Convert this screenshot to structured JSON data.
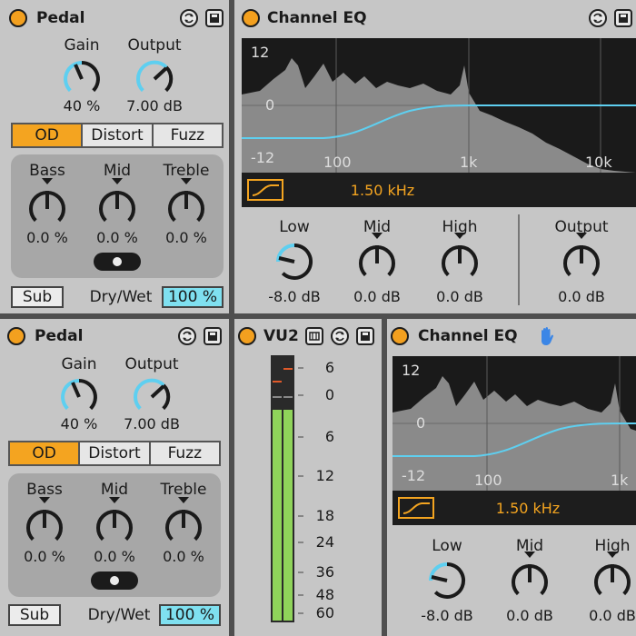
{
  "pedal1": {
    "title": "Pedal",
    "gain_label": "Gain",
    "gain_value": "40 %",
    "output_label": "Output",
    "output_value": "7.00 dB",
    "modes": [
      "OD",
      "Distort",
      "Fuzz"
    ],
    "active_mode": "OD",
    "bass_label": "Bass",
    "bass_value": "0.0 %",
    "mid_label": "Mid",
    "mid_value": "0.0 %",
    "treble_label": "Treble",
    "treble_value": "0.0 %",
    "sub_label": "Sub",
    "drywet_label": "Dry/Wet",
    "drywet_value": "100 %"
  },
  "eq1": {
    "title": "Channel EQ",
    "db_labels": [
      "12",
      "0",
      "-12"
    ],
    "freq_labels": [
      "100",
      "1k",
      "10k"
    ],
    "freq_value": "1.50 kHz",
    "low_label": "Low",
    "low_value": "-8.0 dB",
    "mid_label": "Mid",
    "mid_value": "0.0 dB",
    "high_label": "High",
    "high_value": "0.0 dB",
    "output_label": "Output",
    "output_value": "0.0 dB"
  },
  "pedal2": {
    "title": "Pedal",
    "gain_label": "Gain",
    "gain_value": "40 %",
    "output_label": "Output",
    "output_value": "7.00 dB",
    "modes": [
      "OD",
      "Distort",
      "Fuzz"
    ],
    "active_mode": "OD",
    "bass_label": "Bass",
    "bass_value": "0.0 %",
    "mid_label": "Mid",
    "mid_value": "0.0 %",
    "treble_label": "Treble",
    "treble_value": "0.0 %",
    "sub_label": "Sub",
    "drywet_label": "Dry/Wet",
    "drywet_value": "100 %"
  },
  "vu": {
    "title": "VU2",
    "scale": [
      "6",
      "0",
      "6",
      "12",
      "18",
      "24",
      "36",
      "48",
      "60"
    ]
  },
  "eq2": {
    "title": "Channel EQ",
    "db_labels": [
      "12",
      "0",
      "-12"
    ],
    "freq_labels": [
      "100",
      "1k"
    ],
    "freq_value": "1.50 kHz",
    "low_label": "Low",
    "low_value": "-8.0 dB",
    "mid_label": "Mid",
    "mid_value": "0.0 dB",
    "high_label": "High",
    "high_value": "0.0 dB"
  },
  "colors": {
    "accent": "#f4a420",
    "knob_arc": "#5ecff0",
    "panel": "#c6c6c6",
    "display": "#1a1a1a",
    "meter": "#8fd45a",
    "drywet_bg": "#7fe0f0"
  },
  "icons": [
    "device-on-icon",
    "hot-swap-icon",
    "save-icon",
    "hand-icon",
    "eq-curve-icon",
    "expand-icon"
  ]
}
